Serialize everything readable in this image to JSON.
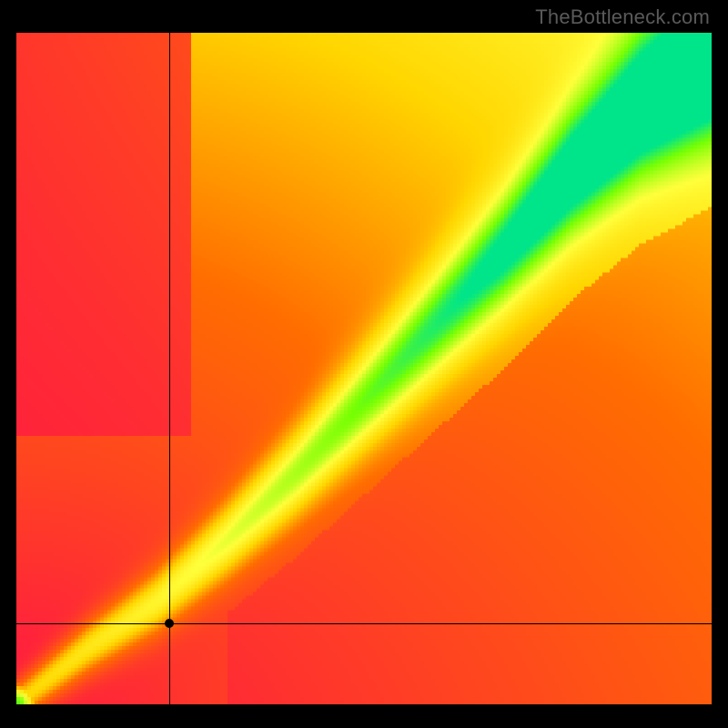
{
  "watermark_text": "TheBottleneck.com",
  "chart_data": {
    "type": "heatmap",
    "title": "",
    "xlabel": "",
    "ylabel": "",
    "x_range": [
      0,
      100
    ],
    "y_range": [
      0,
      100
    ],
    "legend": false,
    "grid": false,
    "crosshair": {
      "x": 22,
      "y": 12
    },
    "marker": {
      "x": 22,
      "y": 12
    },
    "ridge": {
      "description": "optimal-match diagonal band; value peaks along ridge and falls off radially",
      "points": [
        {
          "x": 0,
          "y": 0
        },
        {
          "x": 10,
          "y": 8
        },
        {
          "x": 20,
          "y": 15
        },
        {
          "x": 30,
          "y": 24
        },
        {
          "x": 40,
          "y": 34
        },
        {
          "x": 50,
          "y": 45
        },
        {
          "x": 60,
          "y": 56
        },
        {
          "x": 70,
          "y": 67
        },
        {
          "x": 80,
          "y": 79
        },
        {
          "x": 90,
          "y": 89
        },
        {
          "x": 100,
          "y": 96
        }
      ],
      "band_half_width_start": 3,
      "band_half_width_end": 11
    },
    "colorscale": [
      {
        "stop": 0.0,
        "color": "#ff1744"
      },
      {
        "stop": 0.35,
        "color": "#ff6d00"
      },
      {
        "stop": 0.55,
        "color": "#ffd600"
      },
      {
        "stop": 0.72,
        "color": "#ffff3b"
      },
      {
        "stop": 0.88,
        "color": "#76ff03"
      },
      {
        "stop": 1.0,
        "color": "#00e589"
      }
    ]
  }
}
